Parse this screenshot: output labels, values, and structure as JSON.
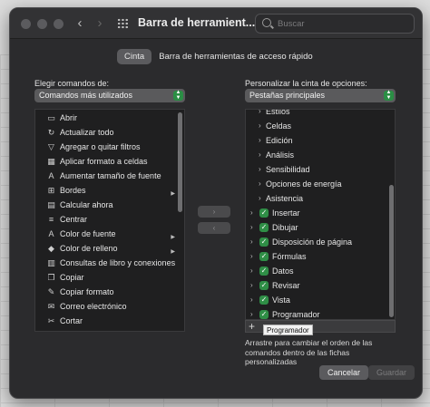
{
  "window": {
    "title": "Barra de herramient...",
    "search_placeholder": "Buscar"
  },
  "tabs": [
    {
      "label": "Cinta",
      "active": true
    },
    {
      "label": "Barra de herramientas de acceso rápido",
      "active": false
    }
  ],
  "left": {
    "label": "Elegir comandos de:",
    "select_value": "Comandos más utilizados",
    "items": [
      {
        "label": "Abrir",
        "icon": "folder-icon"
      },
      {
        "label": "Actualizar todo",
        "icon": "refresh-icon"
      },
      {
        "label": "Agregar o quitar filtros",
        "icon": "filter-icon"
      },
      {
        "label": "Aplicar formato a celdas",
        "icon": "format-cells-icon"
      },
      {
        "label": "Aumentar tamaño de fuente",
        "icon": "font-increase-icon"
      },
      {
        "label": "Bordes",
        "icon": "borders-icon",
        "submenu": true
      },
      {
        "label": "Calcular ahora",
        "icon": "calculator-icon"
      },
      {
        "label": "Centrar",
        "icon": "align-center-icon"
      },
      {
        "label": "Color de fuente",
        "icon": "font-color-icon",
        "submenu": true
      },
      {
        "label": "Color de relleno",
        "icon": "fill-color-icon",
        "submenu": true
      },
      {
        "label": "Consultas de libro y conexiones",
        "icon": "queries-icon"
      },
      {
        "label": "Copiar",
        "icon": "copy-icon"
      },
      {
        "label": "Copiar formato",
        "icon": "format-painter-icon"
      },
      {
        "label": "Correo electrónico",
        "icon": "email-icon"
      },
      {
        "label": "Cortar",
        "icon": "scissors-icon"
      }
    ]
  },
  "middle": {
    "add_glyph": "›",
    "remove_glyph": "‹"
  },
  "right": {
    "label": "Personalizar la cinta de opciones:",
    "select_value": "Pestañas principales",
    "items": [
      {
        "label": "Estilos",
        "level": 1,
        "checked": false
      },
      {
        "label": "Celdas",
        "level": 1,
        "checked": false
      },
      {
        "label": "Edición",
        "level": 1,
        "checked": false
      },
      {
        "label": "Análisis",
        "level": 1,
        "checked": false
      },
      {
        "label": "Sensibilidad",
        "level": 1,
        "checked": false
      },
      {
        "label": "Opciones de energía",
        "level": 1,
        "checked": false
      },
      {
        "label": "Asistencia",
        "level": 1,
        "checked": false
      },
      {
        "label": "Insertar",
        "level": 0,
        "checked": true
      },
      {
        "label": "Dibujar",
        "level": 0,
        "checked": true
      },
      {
        "label": "Disposición de página",
        "level": 0,
        "checked": true
      },
      {
        "label": "Fórmulas",
        "level": 0,
        "checked": true
      },
      {
        "label": "Datos",
        "level": 0,
        "checked": true
      },
      {
        "label": "Revisar",
        "level": 0,
        "checked": true
      },
      {
        "label": "Vista",
        "level": 0,
        "checked": true
      },
      {
        "label": "Programador",
        "level": 0,
        "checked": true
      }
    ],
    "tooltip": "Programador",
    "hint": "Arrastre para cambiar el orden de las comandos dentro de las fichas personalizadas"
  },
  "footer": {
    "cancel_label": "Cancelar",
    "save_label": "Guardar"
  }
}
